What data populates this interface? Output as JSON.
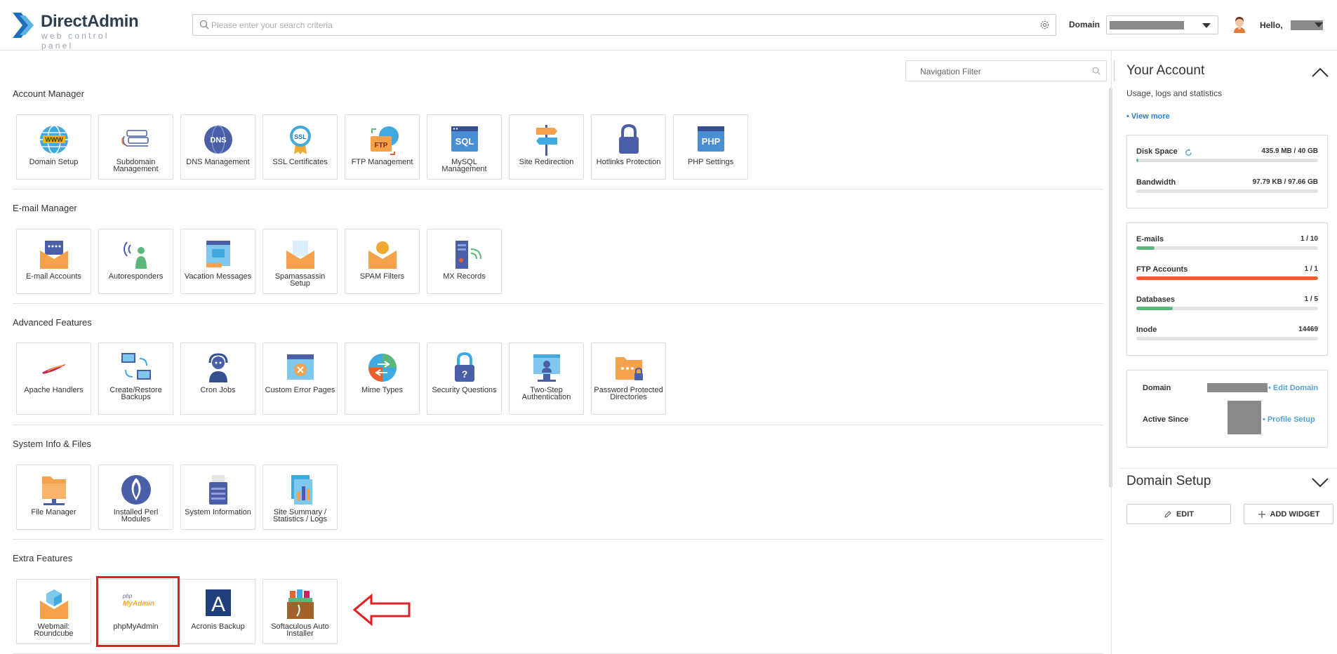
{
  "brand": {
    "name": "DirectAdmin",
    "tagline": "web control panel"
  },
  "header": {
    "search_placeholder": "Please enter your search criteria",
    "domain_label": "Domain",
    "hello": "Hello,"
  },
  "nav_filter_placeholder": "Navigation Filter",
  "sections": [
    {
      "title": "Account Manager",
      "tiles": [
        {
          "label": "Domain Setup"
        },
        {
          "label": "Subdomain Management"
        },
        {
          "label": "DNS Management"
        },
        {
          "label": "SSL Certificates"
        },
        {
          "label": "FTP Management"
        },
        {
          "label": "MySQL Management"
        },
        {
          "label": "Site Redirection"
        },
        {
          "label": "Hotlinks Protection"
        },
        {
          "label": "PHP Settings"
        }
      ]
    },
    {
      "title": "E-mail Manager",
      "tiles": [
        {
          "label": "E-mail Accounts"
        },
        {
          "label": "Autoresponders"
        },
        {
          "label": "Vacation Messages"
        },
        {
          "label": "Spamassassin Setup"
        },
        {
          "label": "SPAM Filters"
        },
        {
          "label": "MX Records"
        }
      ]
    },
    {
      "title": "Advanced Features",
      "tiles": [
        {
          "label": "Apache Handlers"
        },
        {
          "label": "Create/Restore Backups"
        },
        {
          "label": "Cron Jobs"
        },
        {
          "label": "Custom Error Pages"
        },
        {
          "label": "Mime Types"
        },
        {
          "label": "Security Questions"
        },
        {
          "label": "Two-Step Authentication"
        },
        {
          "label": "Password Protected Directories"
        }
      ]
    },
    {
      "title": "System Info & Files",
      "tiles": [
        {
          "label": "File Manager"
        },
        {
          "label": "Installed Perl Modules"
        },
        {
          "label": "System Information"
        },
        {
          "label": "Site Summary / Statistics / Logs"
        }
      ]
    },
    {
      "title": "Extra Features",
      "tiles": [
        {
          "label": "Webmail: Roundcube"
        },
        {
          "label": "phpMyAdmin"
        },
        {
          "label": "Acronis Backup"
        },
        {
          "label": "Softaculous Auto Installer"
        }
      ]
    }
  ],
  "tile_icons": {
    "phpmyadmin_php": "php",
    "phpmyadmin_myadmin": "MyAdmin",
    "acronis_letter": "A",
    "www": "WWW",
    "dns": "DNS",
    "ssl": "SSL",
    "ftp": "FTP",
    "sql": "SQL",
    "php": "PHP"
  },
  "account": {
    "title": "Your Account",
    "subtitle": "Usage, logs and statistics",
    "view_more": "• View more",
    "disk": {
      "name": "Disk Space",
      "value": "435.9 MB / 40 GB",
      "fraction": 0.011
    },
    "bandwidth": {
      "name": "Bandwidth",
      "value": "97.79 KB / 97.66 GB",
      "fraction": 0.0
    },
    "emails": {
      "name": "E-mails",
      "value": "1 / 10",
      "fraction": 0.1
    },
    "ftp": {
      "name": "FTP Accounts",
      "value": "1 / 1",
      "fraction": 1.0
    },
    "databases": {
      "name": "Databases",
      "value": "1 / 5",
      "fraction": 0.2
    },
    "inode": {
      "name": "Inode",
      "value": "14469",
      "fraction": 0.0
    },
    "domain_name": "Domain",
    "edit_domain": "• Edit Domain",
    "active_since": "Active Since",
    "profile_setup": "• Profile Setup"
  },
  "domain_setup": {
    "title": "Domain Setup",
    "edit": "EDIT",
    "add_widget": "ADD WIDGET"
  },
  "colors": {
    "accent_blue": "#2a7fd4",
    "bar_green": "#5cb87a",
    "bar_orange": "#e8612c",
    "highlight_red": "#e02020"
  }
}
